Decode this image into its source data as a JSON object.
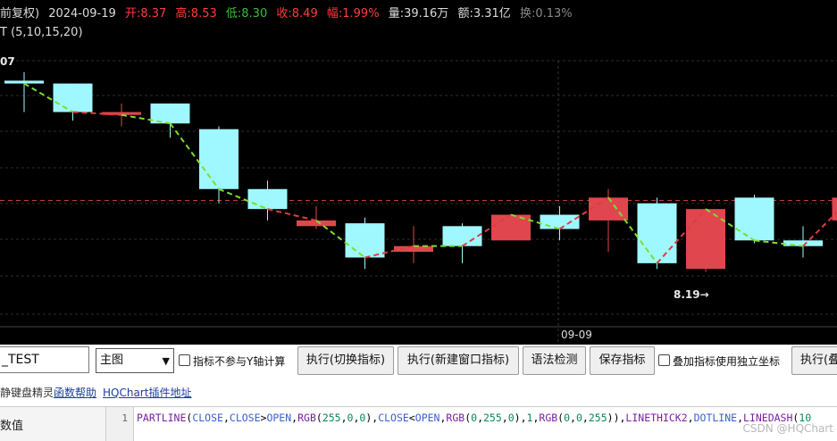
{
  "header": {
    "title_fragment": "前复权)",
    "date": "2024-09-19",
    "open_label": "开:",
    "open": "8.37",
    "high_label": "高:",
    "high": "8.53",
    "low_label": "低:",
    "low": "8.30",
    "close_label": "收:",
    "close": "8.49",
    "change_label": "幅:",
    "change": "1.99%",
    "volume_label": "量:",
    "volume": "39.16万",
    "amount_label": "额:",
    "amount": "3.31亿",
    "turnover_label": "换:",
    "turnover": "0.13%"
  },
  "indicator_title": "T (5,10,15,20)",
  "chart": {
    "top_price_label": "07",
    "low_marker_label": "8.19→",
    "date_axis_label": "09-09",
    "colors": {
      "up": "#e0464e",
      "down": "#9ff8ff",
      "line_up": "#e03c3c",
      "line_down": "#7cde2e",
      "background": "#000000"
    },
    "candles": [
      {
        "o": 8.565,
        "c": 8.56,
        "h": 8.58,
        "l": 8.51,
        "dir": "down"
      },
      {
        "o": 8.56,
        "c": 8.51,
        "h": 8.56,
        "l": 8.495,
        "dir": "down"
      },
      {
        "o": 8.51,
        "c": 8.505,
        "h": 8.525,
        "l": 8.485,
        "dir": "up"
      },
      {
        "o": 8.525,
        "c": 8.49,
        "h": 8.525,
        "l": 8.465,
        "dir": "down"
      },
      {
        "o": 8.48,
        "c": 8.375,
        "h": 8.485,
        "l": 8.35,
        "dir": "down"
      },
      {
        "o": 8.375,
        "c": 8.34,
        "h": 8.39,
        "l": 8.32,
        "dir": "down"
      },
      {
        "o": 8.31,
        "c": 8.32,
        "h": 8.345,
        "l": 8.305,
        "dir": "up"
      },
      {
        "o": 8.315,
        "c": 8.255,
        "h": 8.325,
        "l": 8.235,
        "dir": "down"
      },
      {
        "o": 8.265,
        "c": 8.275,
        "h": 8.31,
        "l": 8.245,
        "dir": "up"
      },
      {
        "o": 8.31,
        "c": 8.275,
        "h": 8.315,
        "l": 8.245,
        "dir": "down"
      },
      {
        "o": 8.285,
        "c": 8.33,
        "h": 8.33,
        "l": 8.29,
        "dir": "up"
      },
      {
        "o": 8.33,
        "c": 8.305,
        "h": 8.345,
        "l": 8.285,
        "dir": "down"
      },
      {
        "o": 8.32,
        "c": 8.36,
        "h": 8.375,
        "l": 8.265,
        "dir": "up"
      },
      {
        "o": 8.35,
        "c": 8.245,
        "h": 8.36,
        "l": 8.235,
        "dir": "down"
      },
      {
        "o": 8.235,
        "c": 8.34,
        "h": 8.34,
        "l": 8.23,
        "dir": "up"
      },
      {
        "o": 8.36,
        "c": 8.285,
        "h": 8.365,
        "l": 8.28,
        "dir": "down"
      },
      {
        "o": 8.285,
        "c": 8.275,
        "h": 8.31,
        "l": 8.255,
        "dir": "down"
      },
      {
        "o": 8.32,
        "c": 8.36,
        "h": 8.365,
        "l": 8.315,
        "dir": "up"
      }
    ],
    "ref_price": 8.355
  },
  "toolbar": {
    "name_value": "_TEST",
    "select_value": "主图",
    "checkbox1_label": "指标不参与Y轴计算",
    "btn_switch": "执行(切换指标)",
    "btn_new_window": "执行(新建窗口指标)",
    "btn_syntax": "语法检测",
    "btn_save": "保存指标",
    "checkbox2_label": "叠加指标使用独立坐标",
    "btn_overlay": "执行(叠"
  },
  "links": {
    "wizard": "静键盘精灵",
    "func_help": "函数帮助",
    "plugin": "HQChart插件地址"
  },
  "editor": {
    "left_label": "数值",
    "line_number": "1",
    "code": "PARTLINE(CLOSE,CLOSE>OPEN,RGB(255,0,0),CLOSE<OPEN,RGB(0,255,0),1,RGB(0,0,255)),LINETHICK2,DOTLINE,LINEDASH(10"
  },
  "watermark": "CSDN @HQChart"
}
